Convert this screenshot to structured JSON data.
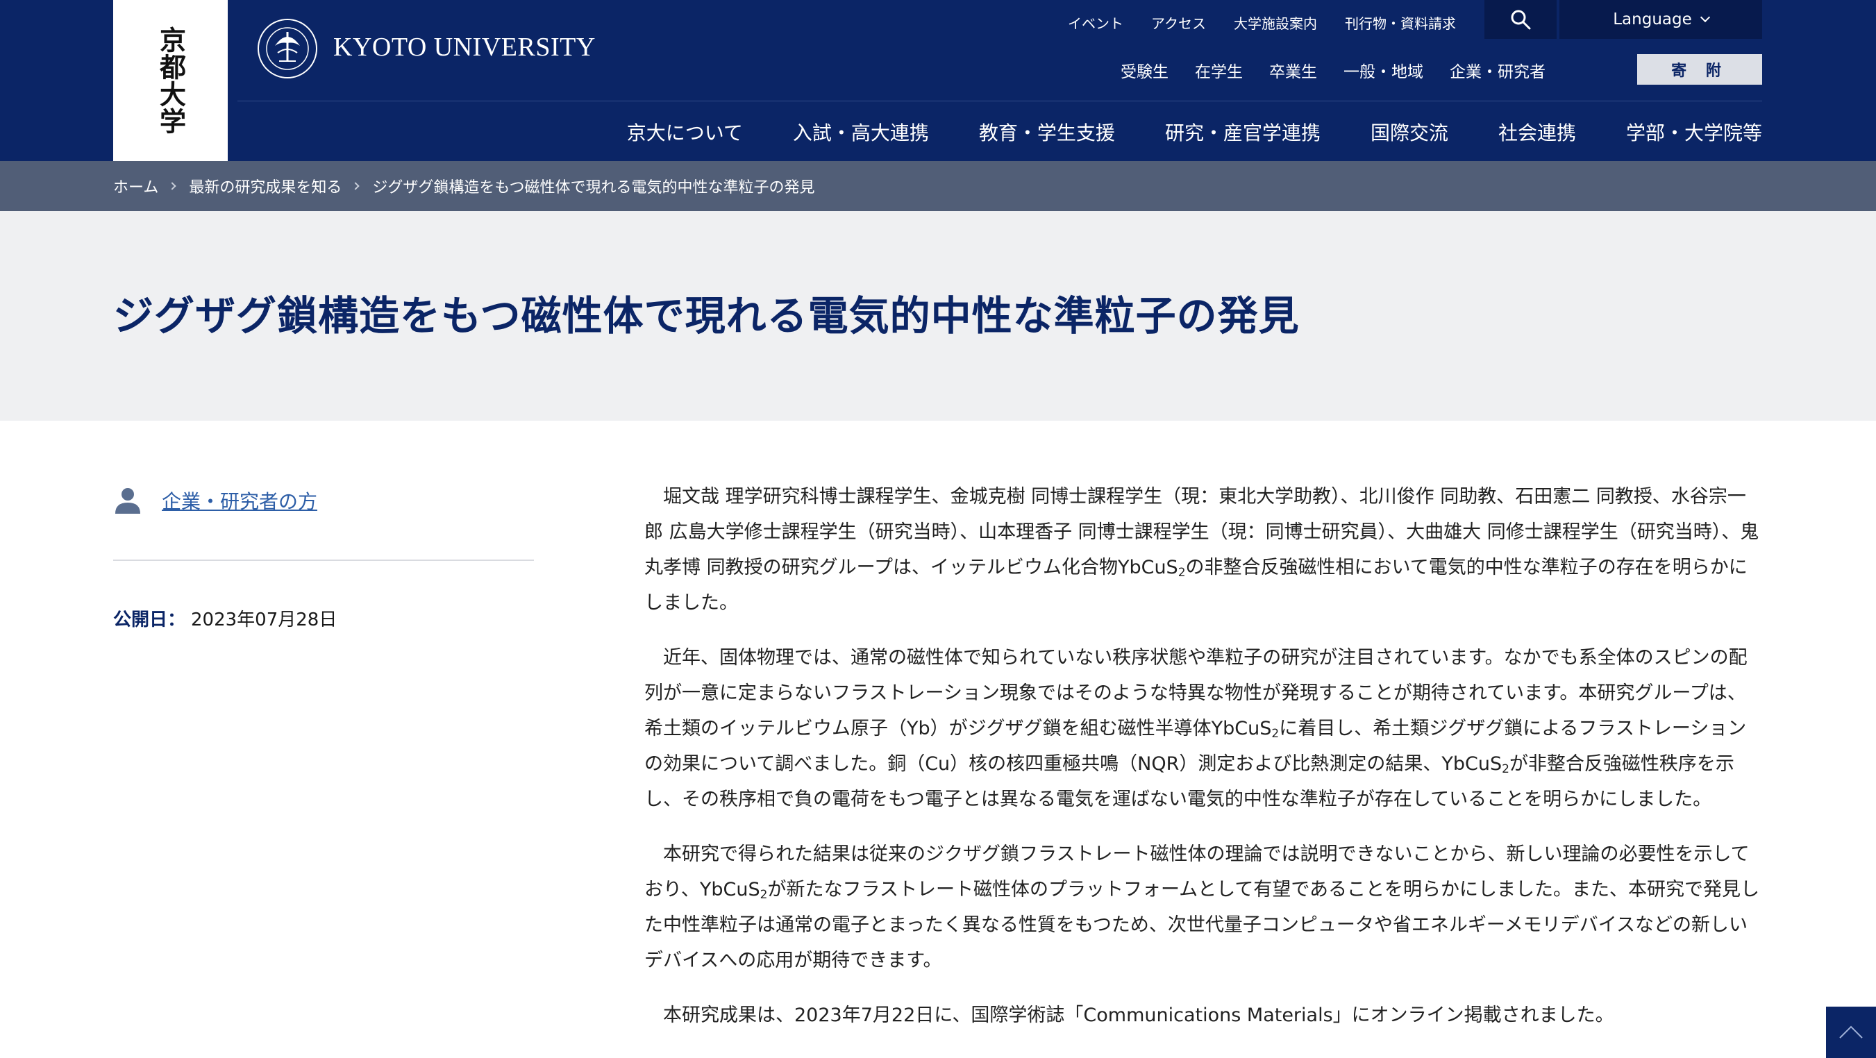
{
  "header": {
    "logo_vertical": "京都大学",
    "wordmark": "KYOTO UNIVERSITY",
    "emblem_icon": "university-emblem-icon",
    "utility_links": [
      "イベント",
      "アクセス",
      "大学施設案内",
      "刊行物・資料請求"
    ],
    "search_icon": "search-icon",
    "language_label": "Language",
    "audience_links": [
      "受験生",
      "在学生",
      "卒業生",
      "一般・地域",
      "企業・研究者"
    ],
    "donate_label": "寄 附",
    "main_nav": [
      "京大について",
      "入試・高大連携",
      "教育・学生支援",
      "研究・産官学連携",
      "国際交流",
      "社会連携",
      "学部・大学院等"
    ]
  },
  "breadcrumb": {
    "items": [
      "ホーム",
      "最新の研究成果を知る",
      "ジグザグ鎖構造をもつ磁性体で現れる電気的中性な準粒子の発見"
    ]
  },
  "page": {
    "title": "ジグザグ鎖構造をもつ磁性体で現れる電気的中性な準粒子の発見"
  },
  "sidebar": {
    "audience_icon": "person-icon",
    "audience_link": "企業・研究者の方",
    "pub_label": "公開日：",
    "pub_date": "2023年07月28日"
  },
  "article": {
    "p1_a": "堀文哉 理学研究科博士課程学生、金城克樹 同博士課程学生（現：東北大学助教）、北川俊作 同助教、石田憲二 同教授、水谷宗一郎 広島大学修士課程学生（研究当時）、山本理香子 同博士課程学生（現：同博士研究員）、大曲雄大 同修士課程学生（研究当時）、鬼丸孝博 同教授の研究グループは、イッテルビウム化合物YbCuS",
    "p1_b": "の非整合反強磁性相において電気的中性な準粒子の存在を明らかにしました。",
    "p2_a": "近年、固体物理では、通常の磁性体で知られていない秩序状態や準粒子の研究が注目されています。なかでも系全体のスピンの配列が一意に定まらないフラストレーション現象ではそのような特異な物性が発現することが期待されています。本研究グループは、希土類のイッテルビウム原子（Yb）がジグザグ鎖を組む磁性半導体YbCuS",
    "p2_b": "に着目し、希土類ジグザグ鎖によるフラストレーションの効果について調べました。銅（Cu）核の核四重極共鳴（NQR）測定および比熱測定の結果、YbCuS",
    "p2_c": "が非整合反強磁性秩序を示し、その秩序相で負の電荷をもつ電子とは異なる電気を運ばない電気的中性な準粒子が存在していることを明らかにしました。",
    "p3_a": "本研究で得られた結果は従来のジクザグ鎖フラストレート磁性体の理論では説明できないことから、新しい理論の必要性を示しており、YbCuS",
    "p3_b": "が新たなフラストレート磁性体のプラットフォームとして有望であることを明らかにしました。また、本研究で発見した中性準粒子は通常の電子とまったく異なる性質をもつため、次世代量子コンピュータや省エネルギーメモリデバイスなどの新しいデバイスへの応用が期待できます。",
    "p4": "本研究成果は、2023年7月22日に、国際学術誌「Communications Materials」にオンライン掲載されました。",
    "subscript": "2"
  },
  "back_to_top_icon": "chevron-up-icon",
  "colors": {
    "header_bg": "#0b2566",
    "breadcrumb_bg": "#515e77",
    "title_band_bg": "#eff0f2",
    "link": "#2d5ea7"
  }
}
